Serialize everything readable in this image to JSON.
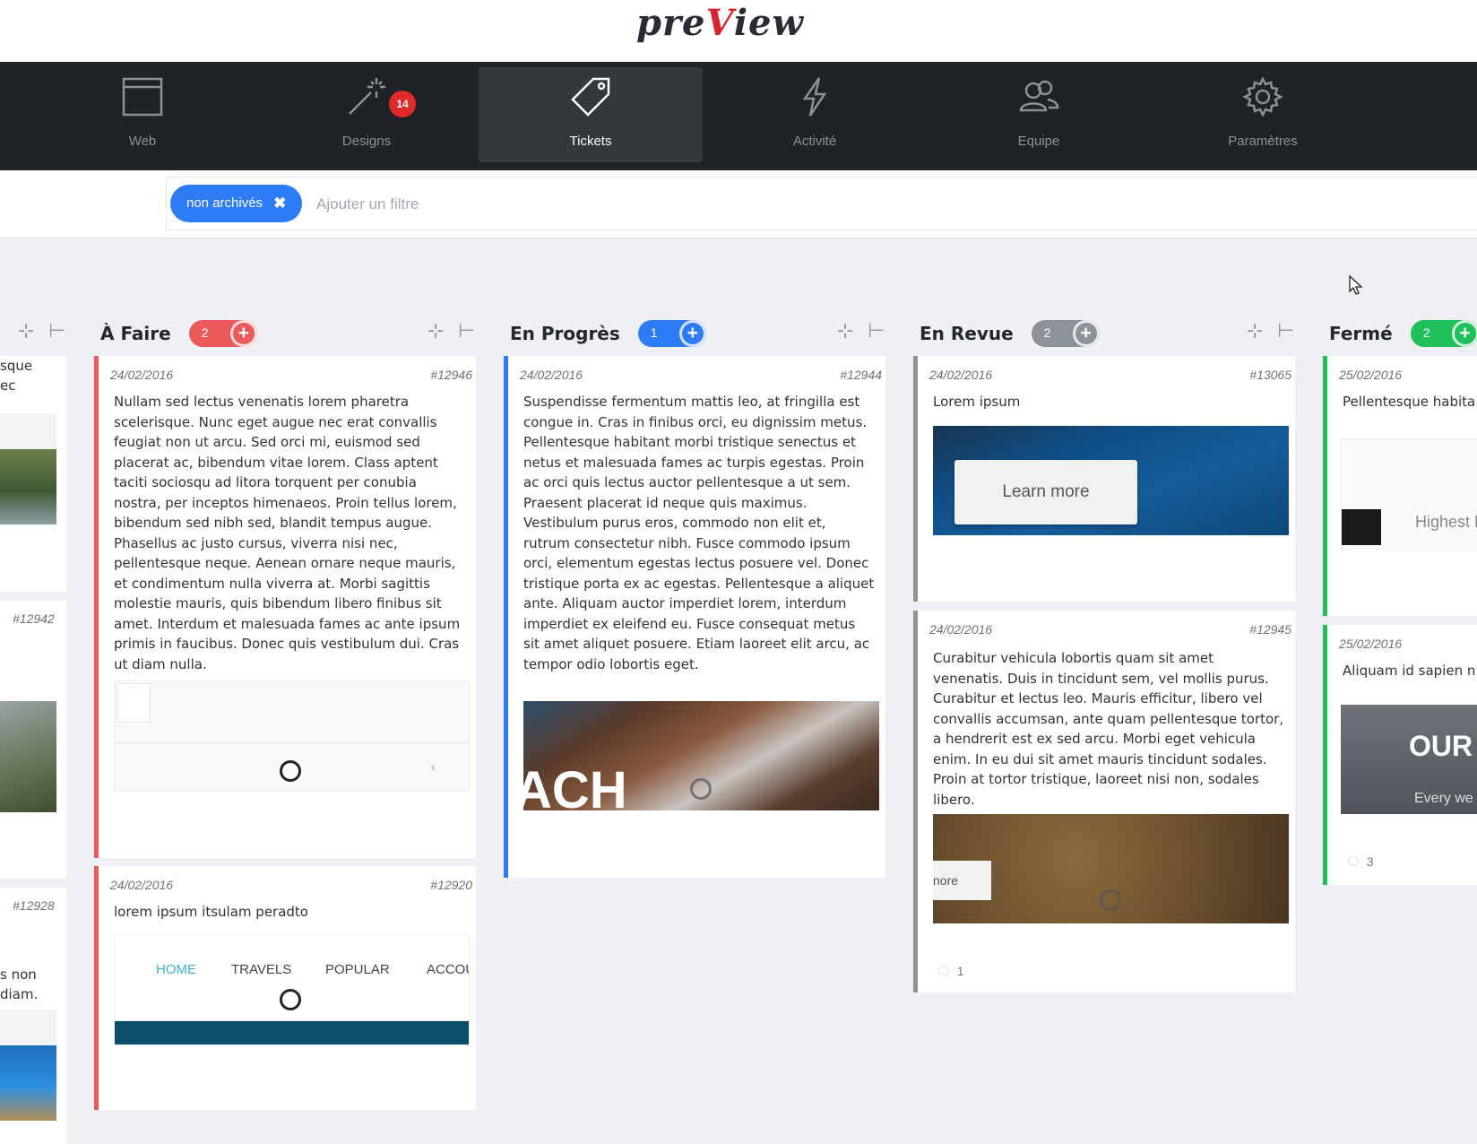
{
  "app": {
    "logo_a": "pre",
    "logo_b": "V",
    "logo_c": "iew"
  },
  "nav": [
    {
      "label": "Web",
      "icon": "browser-window-icon"
    },
    {
      "label": "Designs",
      "icon": "magic-wand-icon",
      "badge": "14"
    },
    {
      "label": "Tickets",
      "icon": "tag-icon",
      "active": true
    },
    {
      "label": "Activité",
      "icon": "lightning-icon"
    },
    {
      "label": "Equipe",
      "icon": "users-icon"
    },
    {
      "label": "Paramètres",
      "icon": "gear-icon"
    }
  ],
  "filter": {
    "chip_label": "non archivés",
    "chip_remove": "✖",
    "placeholder": "Ajouter un filtre"
  },
  "columns": [
    {
      "title": "À Faire",
      "count": "2",
      "color": "#eb5a5a",
      "cards": [
        {
          "date": "24/02/2016",
          "id": "#12946",
          "text": "Nullam sed lectus venenatis lorem pharetra scelerisque. Nunc eget augue nec erat convallis feugiat non ut arcu. Sed orci mi, euismod sed placerat ac, bibendum vitae lorem. Class aptent taciti sociosqu ad litora torquent per conubia nostra, per inceptos himenaeos. Proin tellus lorem, bibendum sed nibh sed, blandit tempus augue. Phasellus ac justo cursus, viverra nisi nec, pellentesque neque. Aenean ornare neque mauris, et condimentum nulla viverra at. Morbi sagittis molestie mauris, quis bibendum libero finibus sit amet. Interdum et malesuada fames ac ante ipsum primis in faucibus. Donec quis vestibulum dui. Cras ut diam nulla."
        },
        {
          "date": "24/02/2016",
          "id": "#12920",
          "text": "lorem ipsum itsulam peradto",
          "thumb_nav": [
            "HOME",
            "TRAVELS",
            "POPULAR",
            "ACCOU"
          ]
        }
      ]
    },
    {
      "title": "En Progrès",
      "count": "1",
      "color": "#2d7cf6",
      "cards": [
        {
          "date": "24/02/2016",
          "id": "#12944",
          "text": "Suspendisse fermentum mattis leo, at fringilla est congue in. Cras in finibus orci, eu dignissim metus. Pellentesque habitant morbi tristique senectus et netus et malesuada fames ac turpis egestas. Proin ac orci quis lectus auctor pellentesque a ut sem. Praesent placerat id neque quis maximus. Vestibulum purus eros, commodo non elit et, rutrum consectetur nibh. Fusce commodo ipsum orci, elementum egestas lectus posuere vel. Donec tristique porta ex ac egestas. Pellentesque a aliquet ante. Aliquam auctor imperdiet lorem, interdum imperdiet ex eleifend eu. Fusce consequat metus sit amet aliquet posuere. Etiam laoreet elit arcu, ac tempor odio lobortis eget.",
          "thumb_text": "ACH"
        }
      ]
    },
    {
      "title": "En Revue",
      "count": "2",
      "color": "#8d939b",
      "cards": [
        {
          "date": "24/02/2016",
          "id": "#13065",
          "text": "Lorem ipsum",
          "thumb_button": "Learn more"
        },
        {
          "date": "24/02/2016",
          "id": "#12945",
          "text": "Curabitur vehicula lobortis quam sit amet venenatis. Duis in tincidunt sem, vel mollis purus. Curabitur et lectus leo. Mauris efficitur, libero vel convallis accumsan, ante quam pellentesque tortor, a hendrerit est ex sed arcu. Morbi eget vehicula enim. In eu dui sit amet mauris tincidunt sodales. Proin at tortor tristique, laoreet nisi non, sodales libero.",
          "thumb_button": "nore",
          "comments": "1"
        }
      ]
    },
    {
      "title": "Fermé",
      "count": "2",
      "color": "#1fbf5a",
      "cards": [
        {
          "date": "25/02/2016",
          "text": "Pellentesque habita netus et malesuada",
          "thumb_text": "Highest H"
        },
        {
          "date": "25/02/2016",
          "text": "Aliquam id sapien n in elit semper",
          "thumb_title": "OUR I",
          "thumb_sub": "Every we",
          "comments": "3"
        }
      ]
    }
  ],
  "left_partial": {
    "text_a": "sque",
    "text_b": "ec",
    "id_a": "#12942",
    "id_b": "#12928",
    "text_c": "s non",
    "text_d": "diam."
  }
}
